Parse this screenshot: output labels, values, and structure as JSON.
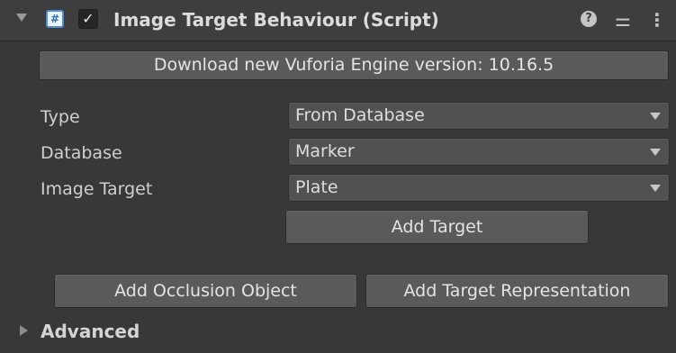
{
  "header": {
    "foldout_icon": "triangle-down",
    "script_icon": "csharp-script-icon",
    "enabled": true,
    "enabled_glyph": "✓",
    "title": "Image Target Behaviour (Script)",
    "icons": [
      "help-icon",
      "presets-icon",
      "menu-icon"
    ]
  },
  "download_button": {
    "label": "Download new Vuforia Engine version: 10.16.5"
  },
  "fields": {
    "type": {
      "label": "Type",
      "value": "From Database"
    },
    "database": {
      "label": "Database",
      "value": "Marker"
    },
    "image_target": {
      "label": "Image Target",
      "value": "Plate"
    }
  },
  "add_target_button": {
    "label": "Add Target"
  },
  "add_occlusion_button": {
    "label": "Add Occlusion Object"
  },
  "add_representation_button": {
    "label": "Add Target Representation"
  },
  "advanced": {
    "label": "Advanced",
    "expanded": false
  },
  "colors": {
    "background": "#383838",
    "header": "#3e3e3e",
    "button": "#5a5a5a",
    "dropdown": "#515151",
    "text": "#d2d2d2"
  }
}
